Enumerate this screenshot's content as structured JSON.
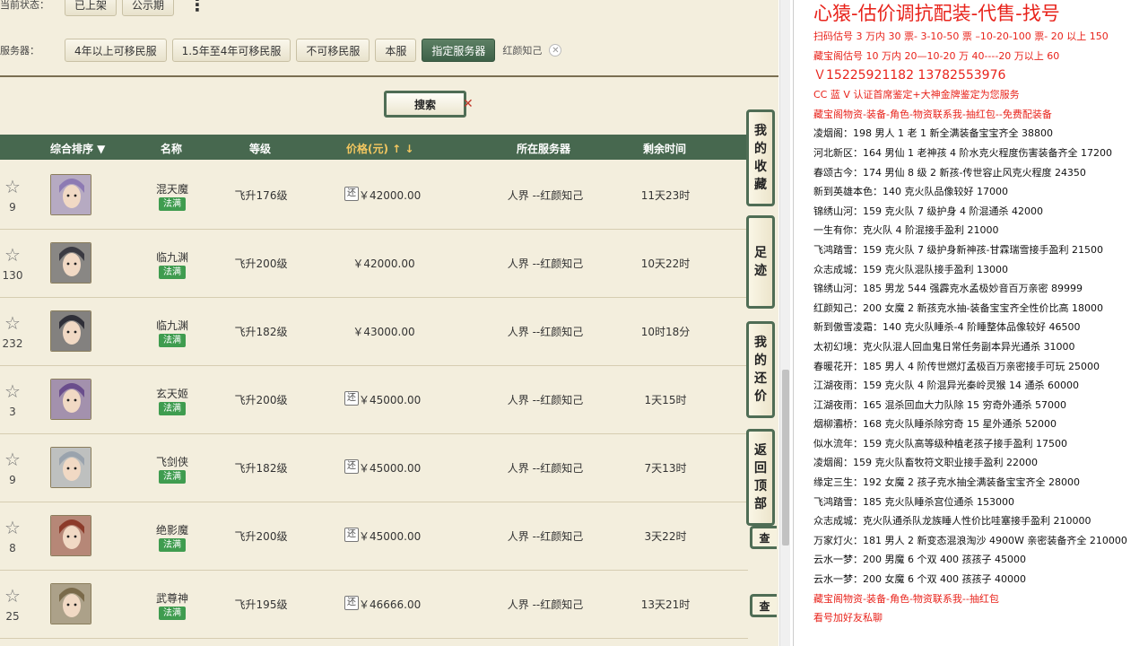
{
  "filters": {
    "status_label": "当前状态：",
    "status_options": [
      "已上架",
      "公示期"
    ],
    "server_label": "服务器：",
    "server_options": [
      "4年以上可移民服",
      "1.5年至4年可移民服",
      "不可移民服",
      "本服",
      "指定服务器"
    ],
    "selected_server": "红颜知己",
    "more_icon": "⋮"
  },
  "search_label": "搜索",
  "table": {
    "headers": {
      "sort": "综合排序 ▼",
      "name": "名称",
      "level": "等级",
      "price": "价格(元) ↑ ↓",
      "server": "所在服务器",
      "remaining": "剩余时间"
    },
    "rows": [
      {
        "fav": "9",
        "name": "混天魔",
        "badge": "法满",
        "level": "飞升176级",
        "returnable": true,
        "price": "￥42000.00",
        "server": "人界 --红颜知己",
        "remaining": "11天23时",
        "avatar_color": "#8d7ab3"
      },
      {
        "fav": "130",
        "name": "临九渊",
        "badge": "法满",
        "level": "飞升200级",
        "returnable": false,
        "price": "￥42000.00",
        "server": "人界 --红颜知己",
        "remaining": "10天22时",
        "avatar_color": "#3a3a42"
      },
      {
        "fav": "232",
        "name": "临九渊",
        "badge": "法满",
        "level": "飞升182级",
        "returnable": false,
        "price": "￥43000.00",
        "server": "人界 --红颜知己",
        "remaining": "10时18分",
        "avatar_color": "#2f2f38"
      },
      {
        "fav": "3",
        "name": "玄天姬",
        "badge": "法满",
        "level": "飞升200级",
        "returnable": true,
        "price": "￥45000.00",
        "server": "人界 --红颜知己",
        "remaining": "1天15时",
        "avatar_color": "#6a4d8c"
      },
      {
        "fav": "9",
        "name": "飞剑侠",
        "badge": "法满",
        "level": "飞升182级",
        "returnable": true,
        "price": "￥45000.00",
        "server": "人界 --红颜知己",
        "remaining": "7天13时",
        "avatar_color": "#9aa3ad"
      },
      {
        "fav": "8",
        "name": "绝影魔",
        "badge": "法满",
        "level": "飞升200级",
        "returnable": true,
        "price": "￥45000.00",
        "server": "人界 --红颜知己",
        "remaining": "3天22时",
        "avatar_color": "#8c3b2a"
      },
      {
        "fav": "25",
        "name": "武尊神",
        "badge": "法满",
        "level": "飞升195级",
        "returnable": true,
        "price": "￥46666.00",
        "server": "人界 --红颜知己",
        "remaining": "13天21时",
        "avatar_color": "#7a6a4a"
      }
    ]
  },
  "side_tabs": [
    {
      "label": [
        "我",
        "的",
        "收",
        "藏"
      ]
    },
    {
      "label": [
        "足",
        "迹"
      ]
    },
    {
      "label": [
        "我",
        "的",
        "还",
        "价"
      ]
    },
    {
      "label": [
        "返",
        "回",
        "顶",
        "部"
      ]
    }
  ],
  "mini_tab_label": "查",
  "notes": {
    "title": "心猿-估价调抗配装-代售-找号",
    "lines": [
      {
        "text": "扫码估号 3 万内 30 票- 3-10-50 票  –10-20-100 票- 20 以上 150",
        "color": "red"
      },
      {
        "text": "藏宝阁估号 10 万内 20—10-20 万 40----20 万以上 60",
        "color": "red"
      },
      {
        "text": "Ｖ15225921182   13782553976",
        "color": "red",
        "size": "big"
      },
      {
        "text": "CC 蓝 V 认证首席鉴定+大神金牌鉴定为您服务",
        "color": "red"
      },
      {
        "text": "藏宝阁物资-装备-角色-物资联系我-抽红包--免费配装备",
        "color": "red"
      },
      {
        "text": "凌烟阁：198 男人 1 老 1 新全满装备宝宝齐全 38800",
        "color": "black"
      },
      {
        "text": "河北新区：164 男仙 1 老神孩 4 阶水克火程度伤害装备齐全 17200",
        "color": "black"
      },
      {
        "text": "春颂古今：174 男仙 8 级 2 新孩-传世容止风克火程度 24350",
        "color": "black"
      },
      {
        "text": "新到英雄本色：140 克火队品像较好 17000",
        "color": "black"
      },
      {
        "text": "锦绣山河：159 克火队 7 级护身 4 阶混通杀 42000",
        "color": "black"
      },
      {
        "text": "一生有你：克火队 4 阶混接手盈利 21000",
        "color": "black"
      },
      {
        "text": "飞鸿踏雪：159 克火队 7 级护身新神孩-甘霖瑞雪接手盈利 21500",
        "color": "black"
      },
      {
        "text": "众志成城：159 克火队混队接手盈利 13000",
        "color": "black"
      },
      {
        "text": "锦绣山河：185 男龙 544 强霹克水孟极妙音百万亲密 89999",
        "color": "black"
      },
      {
        "text": "红颜知己：200 女魔 2 新孩克水抽-装备宝宝齐全性价比高 18000",
        "color": "black"
      },
      {
        "text": "新到傲雪凌霜：140 克火队睡杀-4 阶睡整体品像较好 46500",
        "color": "black"
      },
      {
        "text": "太初幻境：克火队混人回血鬼日常任务副本异光通杀 31000",
        "color": "black"
      },
      {
        "text": "春暖花开：185 男人 4 阶传世燃灯孟极百万亲密接手可玩 25000",
        "color": "black"
      },
      {
        "text": "江湖夜雨：159 克火队 4 阶混异光秦岭灵猴 14 通杀 60000",
        "color": "black"
      },
      {
        "text": "江湖夜雨：165 混杀回血大力队除 15 穷奇外通杀 57000",
        "color": "black"
      },
      {
        "text": "烟柳灞桥：168 克火队睡杀除穷奇 15 星外通杀 52000",
        "color": "black"
      },
      {
        "text": "似水流年：159 克火队高等级种植老孩子接手盈利 17500",
        "color": "black"
      },
      {
        "text": "凌烟阁：159 克火队畜牧符文职业接手盈利 22000",
        "color": "black"
      },
      {
        "text": "缘定三生：192 女魔 2 孩子克水抽全满装备宝宝齐全 28000",
        "color": "black"
      },
      {
        "text": "飞鸿踏雪：185 克火队睡杀宫位通杀 153000",
        "color": "black"
      },
      {
        "text": "众志成城：克火队通杀队龙族睡人性价比哇塞接手盈利 210000",
        "color": "black"
      },
      {
        "text": "万家灯火：181 男人 2 新变态混浪淘沙 4900W 亲密装备齐全 210000",
        "color": "black"
      },
      {
        "text": "云水一梦：200 男魔 6 个双 400 孩孩子 45000",
        "color": "black"
      },
      {
        "text": "云水一梦：200 女魔 6 个双 400 孩孩子 40000",
        "color": "black"
      },
      {
        "text": "藏宝阁物资-装备-角色-物资联系我--抽红包",
        "color": "red"
      },
      {
        "text": "看号加好友私聊",
        "color": "red"
      }
    ]
  }
}
